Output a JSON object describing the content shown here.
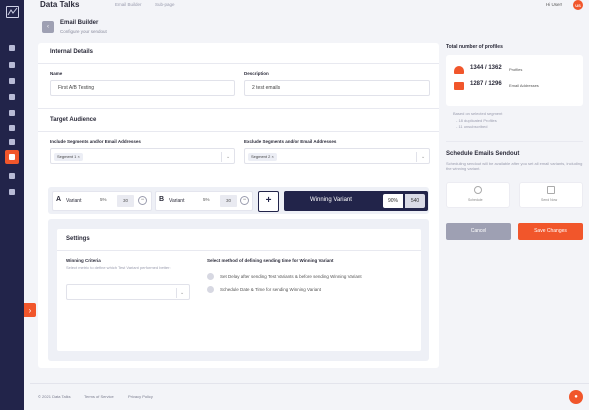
{
  "app": {
    "brand": "Data Talks"
  },
  "breadcrumbs": [
    "Email Builder",
    "Sub-page"
  ],
  "user": {
    "name": "Hi User!",
    "initials": "US"
  },
  "header": {
    "title": "Email Builder",
    "subtitle": "Configure your sendout"
  },
  "internal_details": {
    "title": "Internal Details",
    "name_label": "Name",
    "name_value": "First A/B Testing",
    "description_label": "Description",
    "description_value": "2 test emails"
  },
  "target_audience": {
    "title": "Target Audience",
    "include_label": "Include Segments and/or Email Addresses",
    "include_chip": "Segment 1 ×",
    "exclude_label": "Exclude Segments and/or Email Addresses",
    "exclude_chip": "Segment 2 ×"
  },
  "variants": {
    "a_letter": "A",
    "a_word": "Variant",
    "a_pct": "5%",
    "a_value": "30",
    "b_letter": "B",
    "b_word": "Variant",
    "b_pct": "5%",
    "b_value": "30",
    "minus": "−",
    "plus": "+",
    "winning_label": "Winning Variant",
    "winning_pct": "90%",
    "winning_value": "540"
  },
  "settings": {
    "title": "Settings",
    "criteria_label": "Winning Criteria",
    "criteria_help": "Select metric to define which Test Variant performed better:",
    "criteria_caret": "⌄",
    "method_label": "Select method of defining sending time for Winning Variant",
    "option1": "Set Delay after sending Test Variants & before sending Winning Variant",
    "option2": "Schedule Date & Time for sending Winning Variant"
  },
  "profiles": {
    "title": "Total number of profiles",
    "profiles_count": "1344 / 1362",
    "profiles_unit": "Profiles",
    "emails_count": "1287 / 1296",
    "emails_unit": "Email Addresses",
    "note_title": "Based on selected segment",
    "note_line1": "- 18 duplicated Profiles",
    "note_line2": "- 11 unsubscribed"
  },
  "schedule": {
    "title": "Schedule Emails Sendout",
    "help": "Scheduling sendout will be available after you set all email variants, including the winning variant.",
    "schedule_label": "Schedule",
    "send_now_label": "Send Now"
  },
  "actions": {
    "cancel": "Cancel",
    "save": "Save Changes"
  },
  "footer": {
    "copyright": "© 2021 Data Talks",
    "terms": "Terms of Service",
    "privacy": "Privacy Policy"
  },
  "colors": {
    "accent": "#f1562b",
    "sidebar": "#22244a",
    "muted_button": "#9ea0b3"
  }
}
